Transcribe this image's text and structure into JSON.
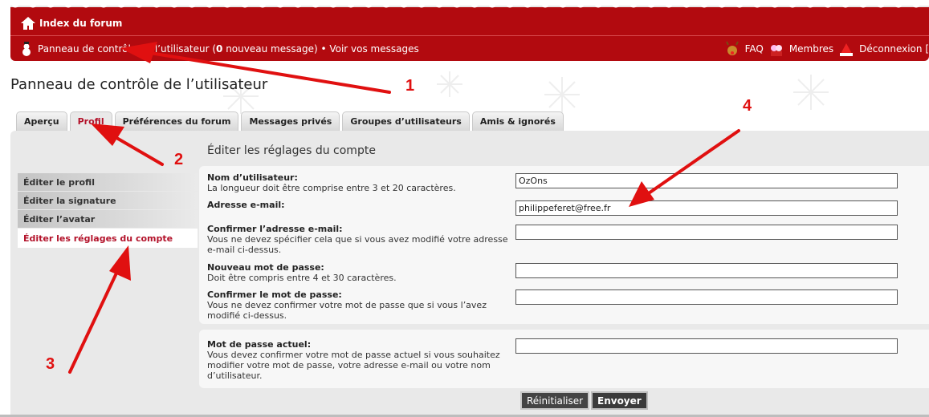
{
  "header": {
    "index_label": "Index du forum",
    "ucp_link_pre": "Panneau de contrôle de l’utilisateur (",
    "new_count": "0",
    "ucp_link_post": " nouveau message) • Voir vos messages",
    "faq": "FAQ",
    "members": "Membres",
    "logout": "Déconnexion [",
    "accent": "#b20a0f"
  },
  "page": {
    "title": "Panneau de contrôle de l’utilisateur"
  },
  "tabs": [
    {
      "label": "Aperçu"
    },
    {
      "label": "Profil"
    },
    {
      "label": "Préférences du forum"
    },
    {
      "label": "Messages privés"
    },
    {
      "label": "Groupes d’utilisateurs"
    },
    {
      "label": "Amis & ignorés"
    }
  ],
  "sidebar": {
    "items": [
      {
        "label": "Éditer le profil"
      },
      {
        "label": "Éditer la signature"
      },
      {
        "label": "Éditer l’avatar"
      },
      {
        "label": "Éditer les réglages du compte"
      }
    ]
  },
  "main": {
    "title": "Éditer les réglages du compte",
    "fields": [
      {
        "label": "Nom d’utilisateur:",
        "help": "La longueur doit être comprise entre 3 et 20 caractères.",
        "value": "OzOns"
      },
      {
        "label": "Adresse e-mail:",
        "help": "",
        "value": "philippeferet@free.fr"
      },
      {
        "label": "Confirmer l’adresse e-mail:",
        "help": "Vous ne devez spécifier cela que si vous avez modifié votre adresse e-mail ci-dessus.",
        "value": ""
      },
      {
        "label": "Nouveau mot de passe:",
        "help": "Doit être compris entre 4 et 30 caractères.",
        "value": ""
      },
      {
        "label": "Confirmer le mot de passe:",
        "help": "Vous ne devez confirmer votre mot de passe que si vous l’avez modifié ci-dessus.",
        "value": ""
      },
      {
        "label": "Mot de passe actuel:",
        "help": "Vous devez confirmer votre mot de passe actuel si vous souhaitez modifier votre mot de passe, votre adresse e-mail ou votre nom d’utilisateur.",
        "value": ""
      }
    ],
    "reset_label": "Réinitialiser",
    "submit_label": "Envoyer"
  },
  "annotations": {
    "n1": "1",
    "n2": "2",
    "n3": "3",
    "n4": "4",
    "color": "#e01010"
  }
}
